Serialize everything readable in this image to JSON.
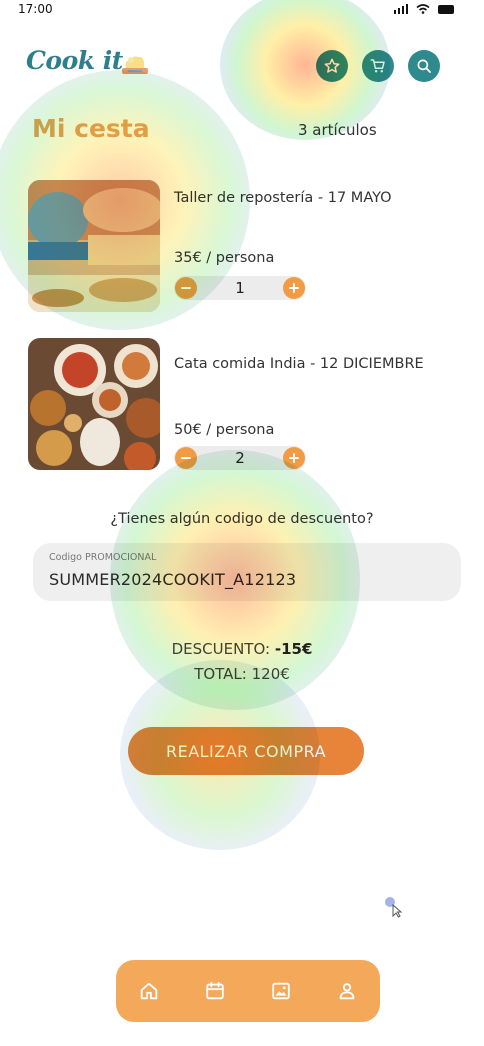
{
  "status_bar": {
    "time": "17:00"
  },
  "app": {
    "logo": "Cook it"
  },
  "header": {
    "icons": [
      "star-icon",
      "cart-icon",
      "search-icon"
    ]
  },
  "cart": {
    "title": "Mi cesta",
    "count": "3 artículos",
    "items": [
      {
        "name": "Taller de repostería - 17 MAYO",
        "price": "35€ / persona",
        "quantity": "1"
      },
      {
        "name": "Cata comida India - 12 DICIEMBRE",
        "price": "50€ / persona",
        "quantity": "2"
      }
    ]
  },
  "discount": {
    "question": "¿Tienes algún codigo de descuento?",
    "label": "Codigo PROMOCIONAL",
    "value": "SUMMER2024COOKIT_A12123"
  },
  "totals": {
    "discount_label": "DESCUENTO:",
    "discount_value": "-15€",
    "total_label": "TOTAL:",
    "total_value": "120€"
  },
  "purchase_button": "REALIZAR COMPRA",
  "bottom_nav": [
    "home-icon",
    "calendar-icon",
    "image-icon",
    "user-icon"
  ],
  "colors": {
    "accent": "#f29b45",
    "teal": "#2f8a8d",
    "title": "#e8a55a"
  }
}
